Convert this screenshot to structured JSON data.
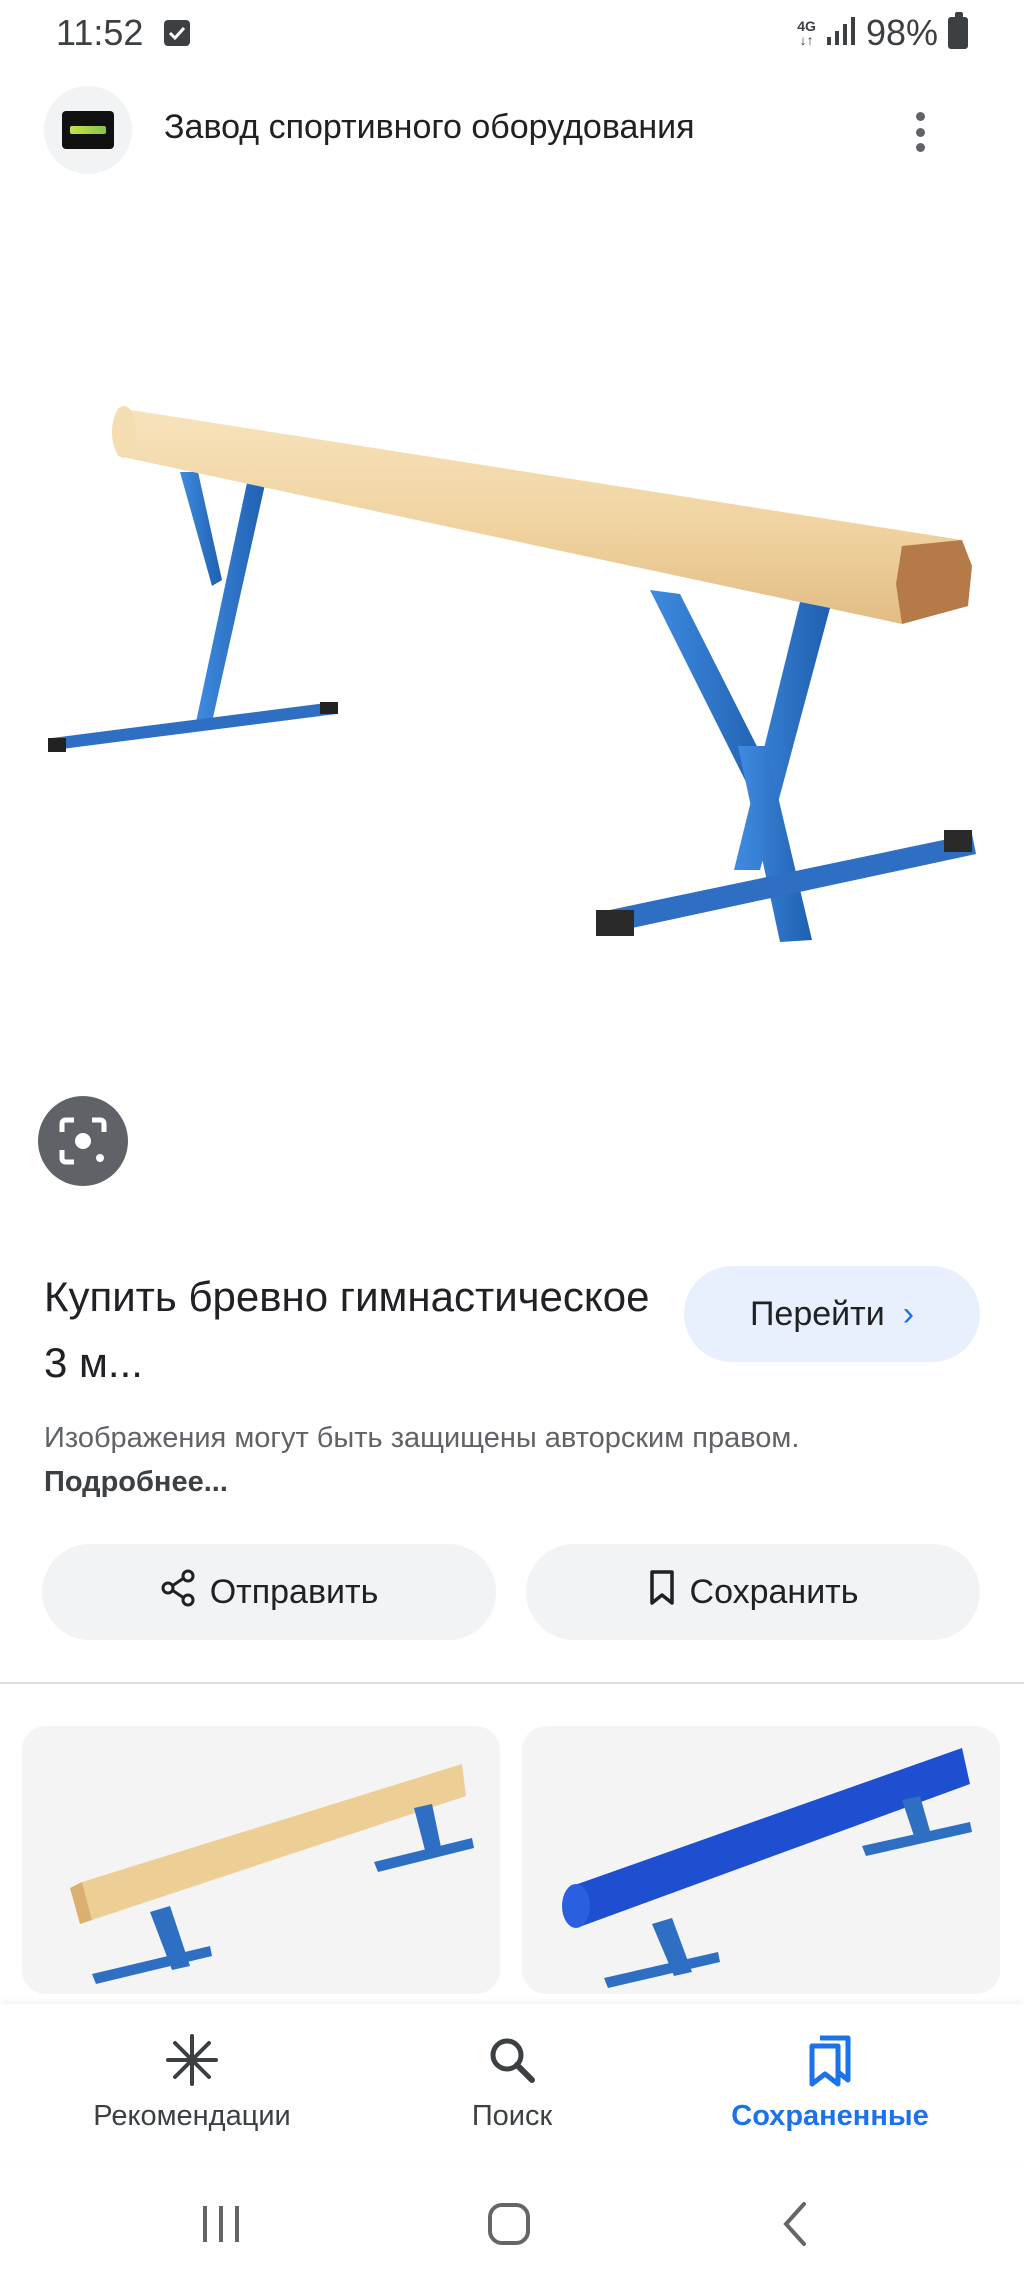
{
  "status_bar": {
    "time": "11:52",
    "network": "4G",
    "battery": "98%"
  },
  "header": {
    "site_title": "Завод спортивного оборудования",
    "logo_icon": "site-logo-icon",
    "menu_icon": "more-vert-icon"
  },
  "result": {
    "title": "Купить бревно гимнастическое 3 м...",
    "goto_label": "Перейти",
    "copyright_text": "Изображения могут быть защищены авторским правом.",
    "more_link": "Подробнее..."
  },
  "actions": {
    "share_label": "Отправить",
    "save_label": "Сохранить"
  },
  "bottom_nav": {
    "items": [
      {
        "label": "Рекомендации",
        "icon": "sparkle-icon"
      },
      {
        "label": "Поиск",
        "icon": "search-icon"
      },
      {
        "label": "Сохраненные",
        "icon": "saved-collections-icon",
        "active": true
      }
    ]
  },
  "colors": {
    "accent": "#1a73e8",
    "beam_wood": "#f2d7a6",
    "beam_blue": "#2f74c8"
  }
}
